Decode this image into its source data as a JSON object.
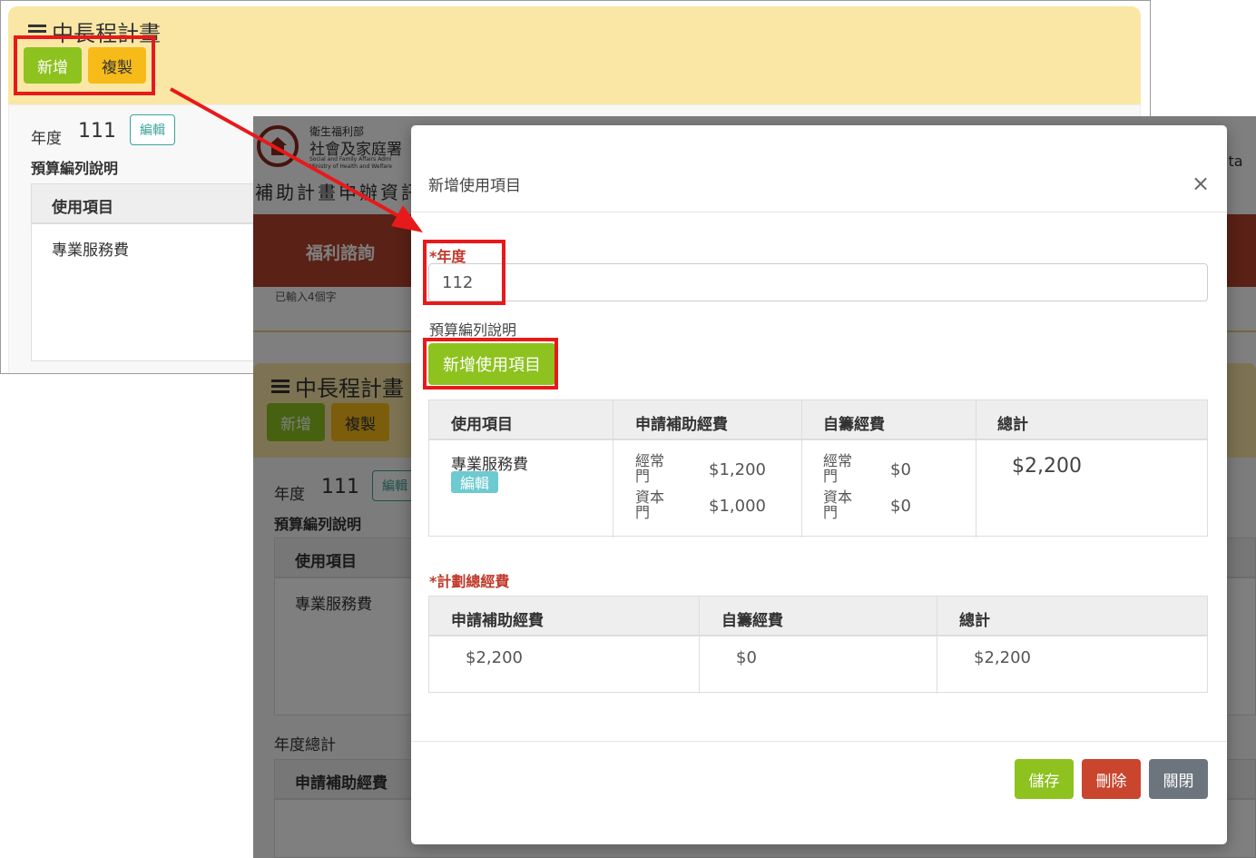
{
  "shot1": {
    "title": "中長程計畫",
    "btn_new": "新增",
    "btn_copy": "複製",
    "year_label": "年度",
    "year_value": "111",
    "edit_label": "編輯",
    "budget_desc_label": "預算編列說明",
    "col_item": "使用項目",
    "row_item": "專業服務費"
  },
  "shot2": {
    "org_name_small": "衛生福利部",
    "org_name": "社會及家庭署",
    "org_en1": "Social and Family Affairs Admi",
    "org_en2": "Ministry of Health and Welfare",
    "system_title": "補助計畫申辦資訊",
    "nav_item": "福利諮詢",
    "char_count": "已輸入4個字",
    "right_text": "ita",
    "title": "中長程計畫",
    "btn_new": "新增",
    "btn_copy": "複製",
    "year_label": "年度",
    "year_value": "111",
    "edit_label": "編輯",
    "budget_desc_label": "預算編列說明",
    "col_item": "使用項目",
    "row_item": "專業服務費",
    "year_total_label": "年度總計",
    "col_apply": "申請補助經費"
  },
  "modal": {
    "title": "新增使用項目",
    "close": "×",
    "year_label": "*年度",
    "year_value": "112",
    "budget_desc_label": "預算編列說明",
    "add_item_button": "新增使用項目",
    "items_table": {
      "headers": [
        "使用項目",
        "申請補助經費",
        "自籌經費",
        "總計"
      ],
      "row": {
        "item": "專業服務費",
        "edit": "編輯",
        "apply_regular_label": "經常門",
        "apply_regular": "$1,200",
        "apply_capital_label": "資本門",
        "apply_capital": "$1,000",
        "self_regular_label": "經常門",
        "self_regular": "$0",
        "self_capital_label": "資本門",
        "self_capital": "$0",
        "total": "$2,200"
      }
    },
    "plan_total_label": "*計劃總經費",
    "totals_table": {
      "headers": [
        "申請補助經費",
        "自籌經費",
        "總計"
      ],
      "values": [
        "$2,200",
        "$0",
        "$2,200"
      ]
    },
    "btn_save": "儲存",
    "btn_delete": "刪除",
    "btn_close": "關閉"
  },
  "colors": {
    "panel_header": "#fbe7a5",
    "green": "#8dc21f",
    "yellow": "#f6bb18",
    "red": "#c9452e",
    "gray": "#6c757d",
    "highlight": "#e8191b",
    "nav_red": "#b5432c"
  }
}
